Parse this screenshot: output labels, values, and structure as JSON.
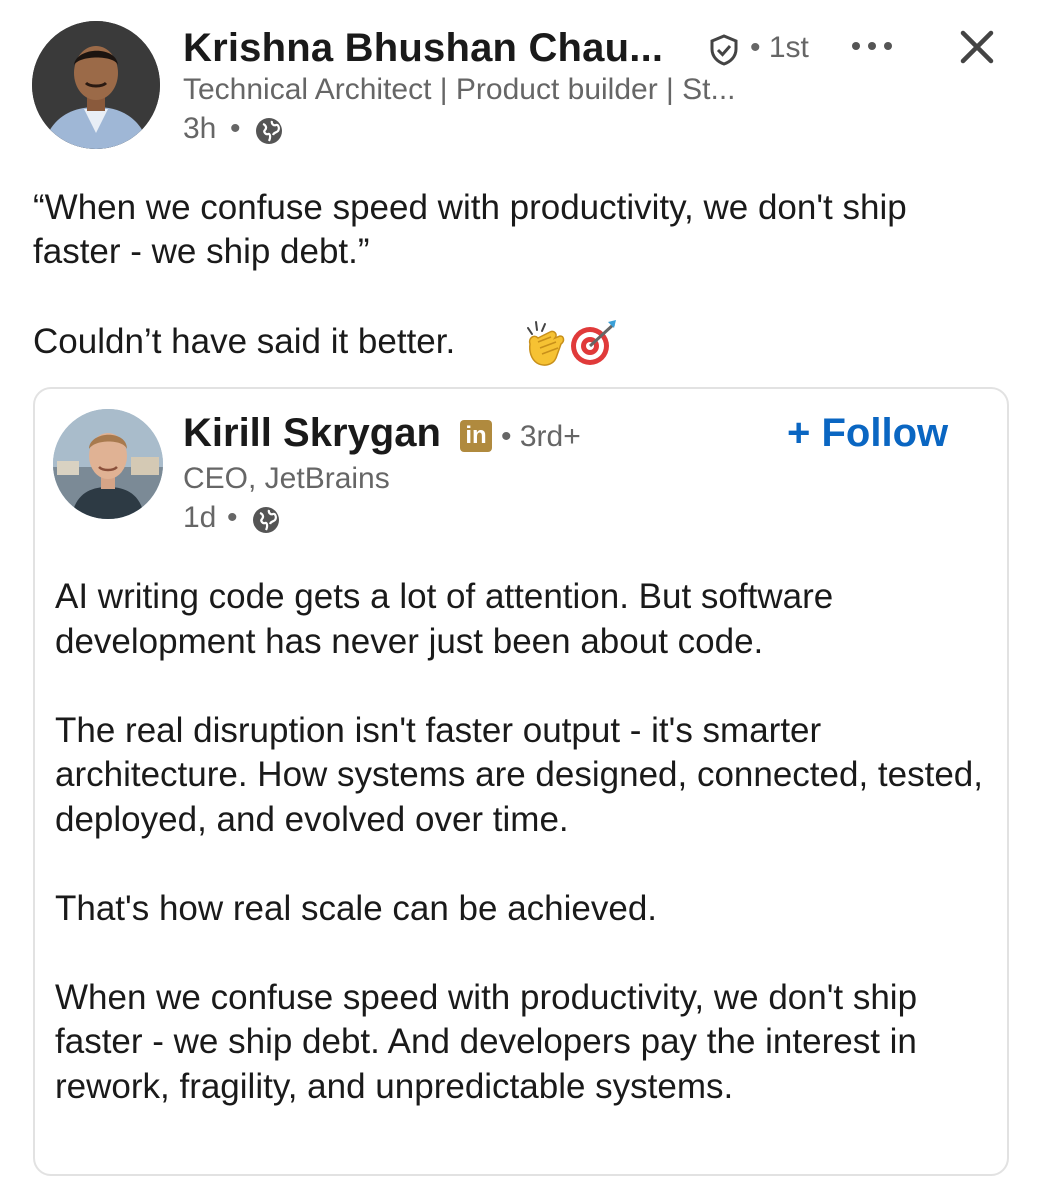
{
  "author": {
    "name": "Krishna Bhushan Chau...",
    "degree": "1st",
    "headline": "Technical Architect | Product builder | St...",
    "time": "3h",
    "separator": "•"
  },
  "post": {
    "quote": "“When we confuse speed with productivity, we don't ship faster - we ship debt.”",
    "comment": "Couldn’t have said it better."
  },
  "shared": {
    "name": "Kirill Skrygan",
    "li_badge": "in",
    "degree": "3rd+",
    "follow_label": "+ Follow",
    "headline": "CEO, JetBrains",
    "time": "1d",
    "separator": "•",
    "paragraphs": [
      "AI writing code gets a lot of attention. But software development has never just been about code.",
      "The real disruption isn't faster output - it's smarter architecture. How systems are designed, connected, tested, deployed, and evolved over time.",
      "That's how real scale can be achieved.",
      "When we confuse speed with productivity, we don't ship faster - we ship debt. And developers pay the interest in rework, fragility, and unpredictable systems."
    ]
  },
  "icons": {
    "verified": "shield-check-icon",
    "more": "more-dots-icon",
    "close": "close-icon",
    "globe": "globe-icon",
    "clap": "clapping-hands-icon",
    "target": "direct-hit-icon"
  },
  "colors": {
    "accent": "#0a66c2",
    "secondary_text": "#666666",
    "premium_badge": "#b08a3e"
  }
}
